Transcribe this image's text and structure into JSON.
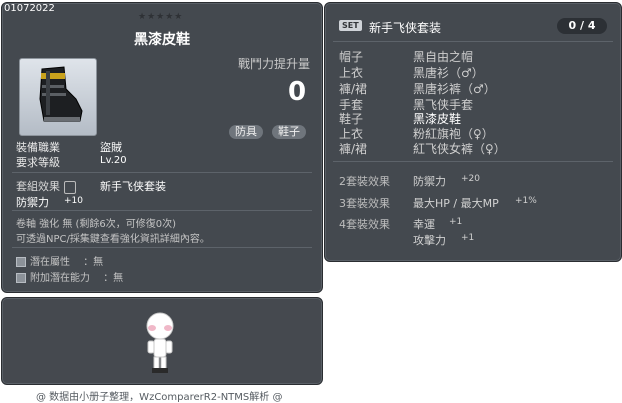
{
  "item": {
    "code": "01072022",
    "stars": "★★★★★",
    "name": "黑漆皮鞋",
    "power_label": "戰鬥力提升量",
    "power_value": "0",
    "tags": [
      "防具",
      "鞋子"
    ],
    "requirements": [
      {
        "label": "裝備職業",
        "value": "盜賊"
      },
      {
        "label": "要求等級",
        "value": "Lv.20"
      }
    ],
    "set_effect_label": "套組效果",
    "set_name": "新手飞侠套装",
    "stat_label": "防禦力",
    "stat_value": "+10",
    "upgrade_line": "卷軸 強化 無 (剩餘6次，可修復0次)",
    "hint_line": "可透過NPC/採集鍵查看強化資訊詳細內容。",
    "potential": [
      {
        "label": "潛在屬性",
        "value": "：無"
      },
      {
        "label": "附加潛在能力",
        "value": "：無"
      }
    ]
  },
  "set": {
    "badge": "SET",
    "title": "新手飞侠套装",
    "count": "0 / 4",
    "pieces": [
      {
        "slot": "帽子",
        "name": "黑自由之帽"
      },
      {
        "slot": "上衣",
        "name": "黑唐衫（♂）"
      },
      {
        "slot": "褲/裙",
        "name": "黑唐衫裤（♂）"
      },
      {
        "slot": "手套",
        "name": "黑飞侠手套"
      },
      {
        "slot": "鞋子",
        "name": "黑漆皮鞋"
      },
      {
        "slot": "上衣",
        "name": "粉紅旗袍（♀）"
      },
      {
        "slot": "褲/裙",
        "name": "紅飞侠女裤（♀）"
      }
    ],
    "effects": [
      {
        "label": "2套裝效果",
        "stats": [
          {
            "name": "防禦力",
            "value": "+20"
          }
        ]
      },
      {
        "label": "3套裝效果",
        "stats": [
          {
            "name": "最大HP / 最大MP",
            "value": "+1%"
          }
        ]
      },
      {
        "label": "4套裝效果",
        "stats": [
          {
            "name": "幸運",
            "value": "+1"
          },
          {
            "name": "攻擊力",
            "value": "+1"
          }
        ]
      }
    ]
  },
  "footer": "@ 数据由小册子整理，WzComparerR2-NTMS解析 @"
}
